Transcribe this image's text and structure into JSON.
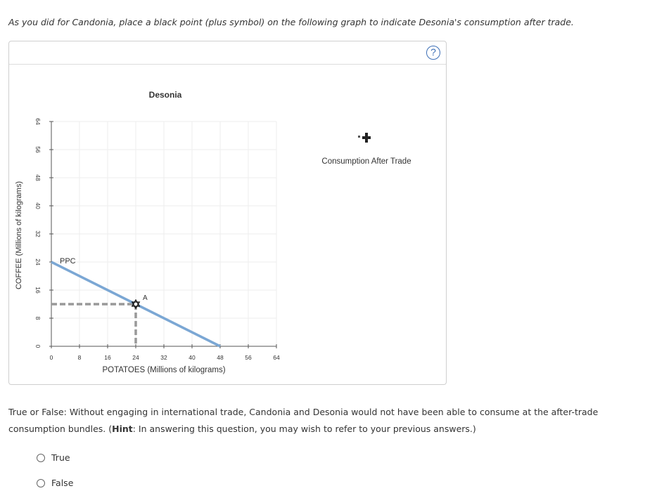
{
  "instruction": "As you did for Candonia, place a black point (plus symbol) on the following graph to indicate Desonia's consumption after trade.",
  "help_label": "?",
  "legend": {
    "label": "Consumption After Trade"
  },
  "chart_data": {
    "type": "line",
    "title": "Desonia",
    "xlabel": "POTATOES (Millions of kilograms)",
    "ylabel": "COFFEE (Millions of kilograms)",
    "xlim": [
      0,
      64
    ],
    "ylim": [
      0,
      64
    ],
    "xticks": [
      0,
      8,
      16,
      24,
      32,
      40,
      48,
      56,
      64
    ],
    "yticks": [
      0,
      8,
      16,
      24,
      32,
      40,
      48,
      56,
      64
    ],
    "grid": true,
    "series": [
      {
        "name": "PPC",
        "points": [
          [
            0,
            24
          ],
          [
            48,
            0
          ]
        ],
        "color": "#7ba7d4"
      }
    ],
    "point_A": {
      "label": "A",
      "x": 24,
      "y": 12
    },
    "ppc_label": "PPC"
  },
  "question": {
    "prefix": "True or False: Without engaging in international trade, Candonia and Desonia would not have been able to consume at the after-trade consumption bundles. (",
    "hint_label": "Hint",
    "suffix": ": In answering this question, you may wish to refer to your previous answers.)"
  },
  "options": [
    "True",
    "False"
  ]
}
